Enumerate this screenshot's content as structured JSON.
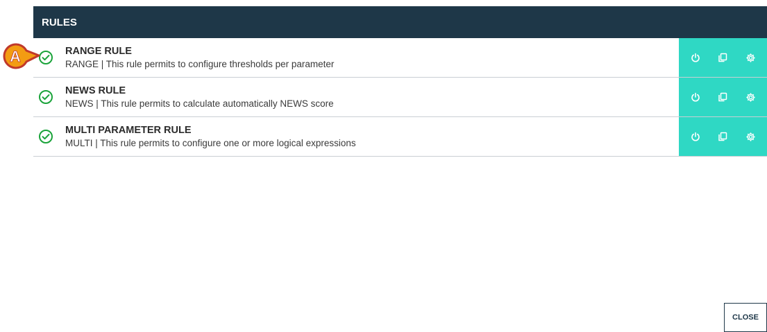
{
  "header": {
    "title": "RULES"
  },
  "rules": [
    {
      "title": "RANGE RULE",
      "description": "RANGE | This rule permits to configure thresholds per parameter",
      "status_icon": "check-circle-icon"
    },
    {
      "title": "NEWS RULE",
      "description": "NEWS | This rule permits to calculate automatically NEWS score",
      "status_icon": "check-circle-icon"
    },
    {
      "title": "MULTI PARAMETER RULE",
      "description": "MULTI | This rule permits to configure one or more logical expressions",
      "status_icon": "check-circle-icon"
    }
  ],
  "actions": [
    "power-icon",
    "copy-icon",
    "settings-icon"
  ],
  "callout": {
    "label": "A"
  },
  "footer": {
    "close_label": "CLOSE"
  },
  "colors": {
    "header_bg": "#1e3748",
    "actions_bg": "#2fd8c4",
    "status_green": "#1aa33a",
    "callout_fill": "#f39c12",
    "callout_border": "#c0392b"
  }
}
